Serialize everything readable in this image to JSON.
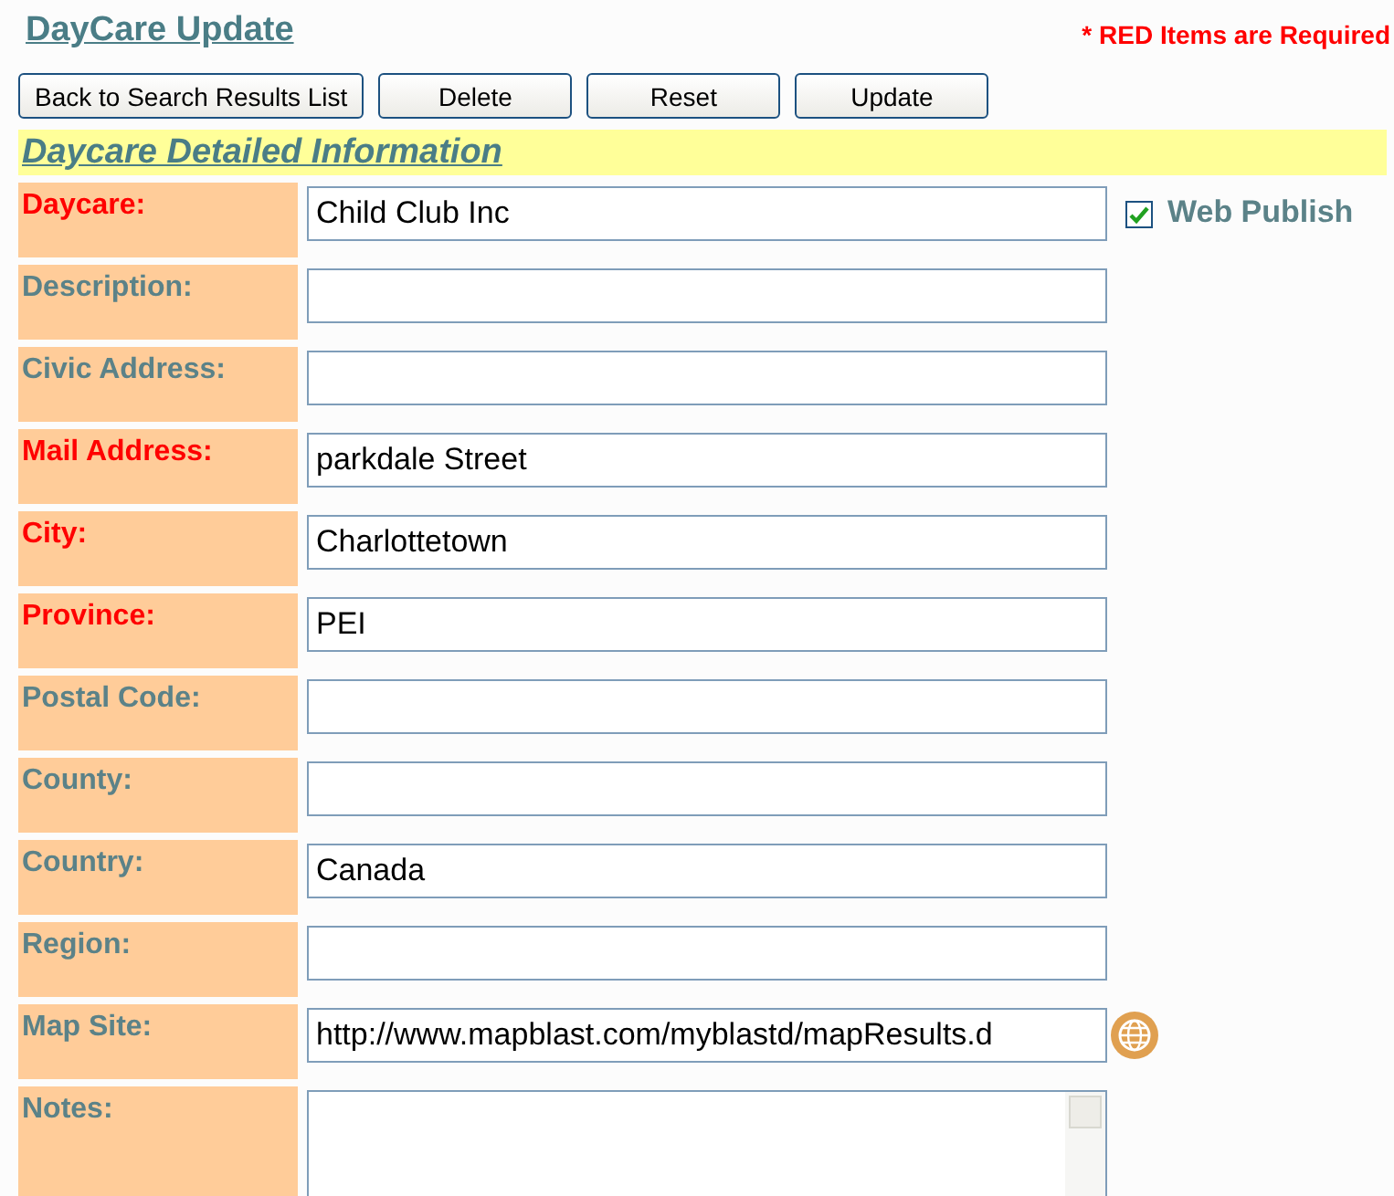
{
  "page_title": "DayCare Update",
  "required_note": "* RED Items are Required",
  "buttons": [
    "Back to Search Results List",
    "Delete",
    "Reset",
    "Update"
  ],
  "section_title": "Daycare Detailed Information",
  "fields": [
    {
      "label": "Daycare:",
      "required": true,
      "kind": "text",
      "value": "Child Club Inc",
      "checkbox": {
        "label": "Web Publish",
        "checked": true
      }
    },
    {
      "label": "Description:",
      "required": false,
      "kind": "text"
    },
    {
      "label": "Civic Address:",
      "required": false,
      "kind": "text"
    },
    {
      "label": "Mail Address:",
      "required": true,
      "kind": "text",
      "value": "parkdale Street"
    },
    {
      "label": "City:",
      "required": true,
      "kind": "text",
      "value": "Charlottetown"
    },
    {
      "label": "Province:",
      "required": true,
      "kind": "text",
      "value": "PEI"
    },
    {
      "label": "Postal Code:",
      "required": false,
      "kind": "text"
    },
    {
      "label": "County:",
      "required": false,
      "kind": "text"
    },
    {
      "label": "Country:",
      "required": false,
      "kind": "text",
      "value": "Canada"
    },
    {
      "label": "Region:",
      "required": false,
      "kind": "text"
    },
    {
      "label": "Map Site:",
      "required": false,
      "kind": "link",
      "value": "http://www.mapblast.com/myblastd/mapResults.d"
    },
    {
      "label": "Notes:",
      "required": false,
      "kind": "textarea"
    }
  ]
}
